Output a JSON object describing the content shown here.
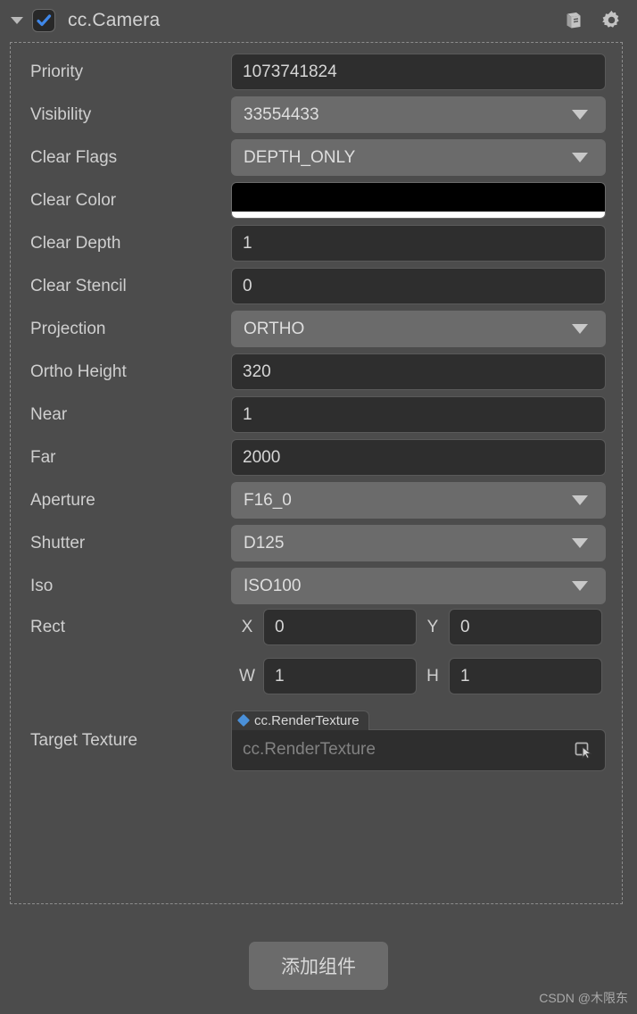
{
  "header": {
    "fold_icon": "chevron-down-icon",
    "enabled": true,
    "title": "cc.Camera",
    "help_icon": "book-icon",
    "settings_icon": "gear-icon"
  },
  "colors": {
    "panel_bg": "#4c4c4c",
    "input_bg": "#2e2e2e",
    "dropdown_bg": "#6b6b6b",
    "accent_blue": "#4a90d9",
    "clear_color": "#000000",
    "clear_color_alpha": "#ffffff",
    "text": "#cfcfcf"
  },
  "properties": [
    {
      "label": "Priority",
      "kind": "input",
      "value": "1073741824"
    },
    {
      "label": "Visibility",
      "kind": "dropdown",
      "value": "33554433"
    },
    {
      "label": "Clear Flags",
      "kind": "dropdown",
      "value": "DEPTH_ONLY"
    },
    {
      "label": "Clear Color",
      "kind": "color",
      "value": "#000000"
    },
    {
      "label": "Clear Depth",
      "kind": "input",
      "value": "1"
    },
    {
      "label": "Clear Stencil",
      "kind": "input",
      "value": "0"
    },
    {
      "label": "Projection",
      "kind": "dropdown",
      "value": "ORTHO"
    },
    {
      "label": "Ortho Height",
      "kind": "input",
      "value": "320"
    },
    {
      "label": "Near",
      "kind": "input",
      "value": "1"
    },
    {
      "label": "Far",
      "kind": "input",
      "value": "2000"
    },
    {
      "label": "Aperture",
      "kind": "dropdown",
      "value": "F16_0"
    },
    {
      "label": "Shutter",
      "kind": "dropdown",
      "value": "D125"
    },
    {
      "label": "Iso",
      "kind": "dropdown",
      "value": "ISO100"
    }
  ],
  "rect": {
    "label": "Rect",
    "x": {
      "label": "X",
      "value": "0"
    },
    "y": {
      "label": "Y",
      "value": "0"
    },
    "w": {
      "label": "W",
      "value": "1"
    },
    "h": {
      "label": "H",
      "value": "1"
    }
  },
  "target_texture": {
    "label": "Target Texture",
    "badge": "cc.RenderTexture",
    "placeholder": "cc.RenderTexture",
    "value": "",
    "picker_icon": "select-node-icon"
  },
  "add_component": {
    "label": "添加组件"
  },
  "watermark": {
    "text": "CSDN @木限东"
  }
}
